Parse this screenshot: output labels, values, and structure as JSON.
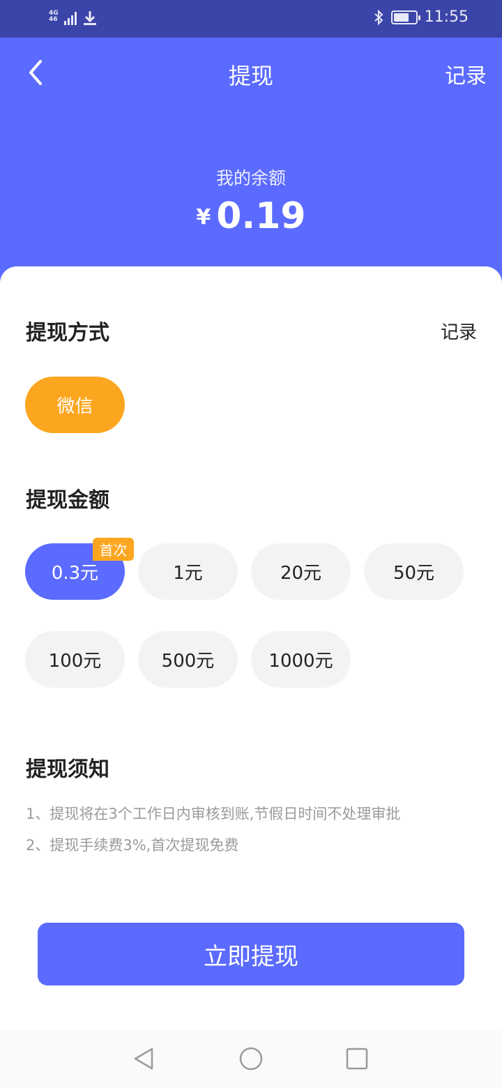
{
  "status_bar": {
    "network_top": "4G",
    "network_bottom": "46",
    "time": "11:55",
    "icons": [
      "signal-icon",
      "download-icon",
      "bluetooth-icon",
      "battery-icon"
    ]
  },
  "header": {
    "title": "提现",
    "record_label": "记录",
    "balance_label": "我的余额",
    "currency_symbol": "¥",
    "balance_value": "0.19"
  },
  "withdraw_method": {
    "title": "提现方式",
    "record_label": "记录",
    "options": [
      {
        "label": "微信",
        "selected": true
      }
    ]
  },
  "withdraw_amount": {
    "title": "提现金额",
    "first_time_badge": "首次",
    "options": [
      {
        "label": "0.3元",
        "selected": true
      },
      {
        "label": "1元",
        "selected": false
      },
      {
        "label": "20元",
        "selected": false
      },
      {
        "label": "50元",
        "selected": false
      },
      {
        "label": "100元",
        "selected": false
      },
      {
        "label": "500元",
        "selected": false
      },
      {
        "label": "1000元",
        "selected": false
      }
    ]
  },
  "notice": {
    "title": "提现须知",
    "lines": [
      "1、提现将在3个工作日内审核到账,节假日时间不处理审批",
      "2、提现手续费3%,首次提现免费"
    ]
  },
  "submit_label": "立即提现",
  "colors": {
    "primary": "#5b6bff",
    "status_bar": "#3b44a8",
    "accent_orange": "#fca61f",
    "pill_grey": "#f3f3f3"
  }
}
